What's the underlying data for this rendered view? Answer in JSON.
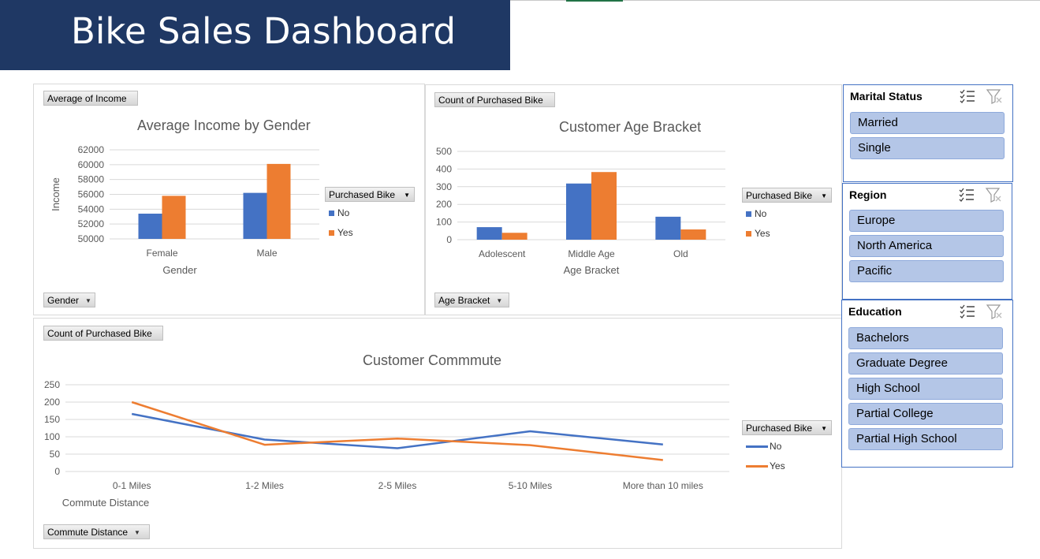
{
  "dashboard": {
    "title": "Bike Sales Dashboard"
  },
  "colors": {
    "no": "#4472c4",
    "yes": "#ed7d31",
    "banner": "#1f3864",
    "slicer_item": "#b4c6e7"
  },
  "charts": {
    "income": {
      "value_field": "Average of Income",
      "axis_field": "Gender",
      "legend_field": "Purchased Bike",
      "chart_data": {
        "type": "bar",
        "title": "Average Income by Gender",
        "xlabel": "Gender",
        "ylabel": "Income",
        "categories": [
          "Female",
          "Male"
        ],
        "series": [
          {
            "name": "No",
            "values": [
              53400,
              56200
            ]
          },
          {
            "name": "Yes",
            "values": [
              55800,
              60100
            ]
          }
        ],
        "ylim": [
          50000,
          62000
        ],
        "yticks": [
          "62000",
          "60000",
          "58000",
          "56000",
          "54000",
          "52000",
          "50000"
        ],
        "legend": "right",
        "grid": true
      }
    },
    "age": {
      "value_field": "Count of Purchased Bike",
      "axis_field": "Age Bracket",
      "legend_field": "Purchased Bike",
      "chart_data": {
        "type": "bar",
        "title": "Customer Age Bracket",
        "xlabel": "Age Bracket",
        "ylabel": "",
        "categories": [
          "Adolescent",
          "Middle Age",
          "Old"
        ],
        "series": [
          {
            "name": "No",
            "values": [
              71,
              318,
              130
            ]
          },
          {
            "name": "Yes",
            "values": [
              39,
              383,
              58
            ]
          }
        ],
        "ylim": [
          0,
          500
        ],
        "yticks": [
          "500",
          "400",
          "300",
          "200",
          "100",
          "0"
        ],
        "legend": "right",
        "grid": true
      }
    },
    "commute": {
      "value_field": "Count of Purchased Bike",
      "axis_field": "Commute Distance",
      "legend_field": "Purchased Bike",
      "chart_data": {
        "type": "line",
        "title": "Customer Commmute",
        "xlabel": "Commute Distance",
        "ylabel": "",
        "categories": [
          "0-1 Miles",
          "1-2 Miles",
          "2-5 Miles",
          "5-10 Miles",
          "More than 10 miles"
        ],
        "series": [
          {
            "name": "No",
            "values": [
              166,
              92,
              67,
              116,
              78
            ]
          },
          {
            "name": "Yes",
            "values": [
              200,
              77,
              95,
              76,
              33
            ]
          }
        ],
        "ylim": [
          0,
          250
        ],
        "yticks": [
          "250",
          "200",
          "150",
          "100",
          "50",
          "0"
        ],
        "legend": "right",
        "grid": true
      }
    }
  },
  "slicers": {
    "marital": {
      "title": "Marital Status",
      "items": [
        "Married",
        "Single"
      ]
    },
    "region": {
      "title": "Region",
      "items": [
        "Europe",
        "North America",
        "Pacific"
      ]
    },
    "education": {
      "title": "Education",
      "items": [
        "Bachelors",
        "Graduate Degree",
        "High School",
        "Partial College",
        "Partial High School"
      ]
    }
  },
  "icons": {
    "multiselect": "multi-select-icon",
    "clear_filter": "clear-filter-icon",
    "dropdown": "dropdown-arrow-icon"
  }
}
